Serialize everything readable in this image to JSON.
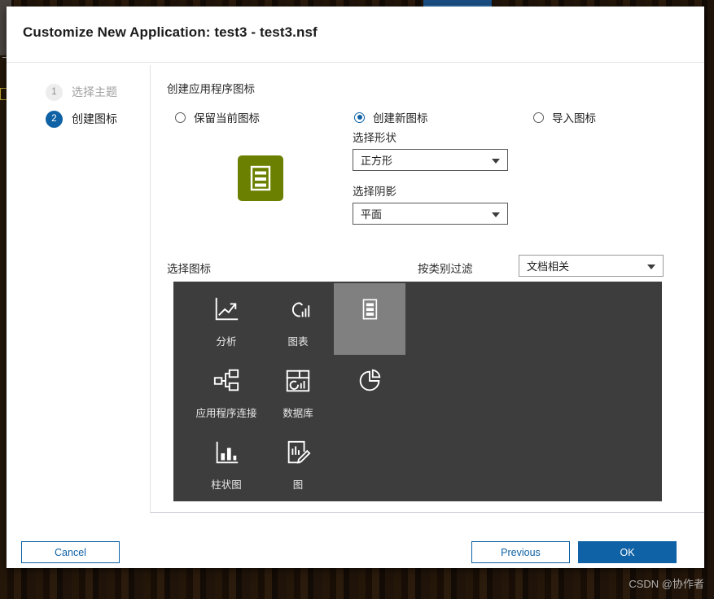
{
  "window": {
    "title": "Customize New Application: test3 - test3.nsf"
  },
  "steps": [
    {
      "number": "1",
      "label": "选择主题",
      "state": "inactive"
    },
    {
      "number": "2",
      "label": "创建图标",
      "state": "active"
    }
  ],
  "content": {
    "section_label": "创建应用程序图标",
    "radios": [
      {
        "label": "保留当前图标",
        "checked": false,
        "name": "keep-current-icon"
      },
      {
        "label": "创建新图标",
        "checked": true,
        "name": "create-new-icon"
      },
      {
        "label": "导入图标",
        "checked": false,
        "name": "import-icon"
      }
    ],
    "shape_field": {
      "label": "选择形状",
      "value": "正方形"
    },
    "shadow_field": {
      "label": "选择阴影",
      "value": "平面"
    },
    "preview": {
      "background_color": "#6b8000",
      "icon": "document-list-icon"
    }
  },
  "chooser": {
    "title": "选择图标",
    "filter_label": "按类别过滤",
    "filter_value": "文档相关",
    "icons": [
      {
        "caption": "分析",
        "icon": "line-chart-arrow-icon",
        "selected": false
      },
      {
        "caption": "图表",
        "icon": "cloud-bars-icon",
        "selected": false
      },
      {
        "caption": "",
        "icon": "document-list-icon",
        "selected": true
      },
      {
        "caption": "应用程序连接",
        "icon": "app-connection-icon",
        "selected": false
      },
      {
        "caption": "数据库",
        "icon": "database-dashboard-icon",
        "selected": false
      },
      {
        "caption": "",
        "icon": "pie-chart-icon",
        "selected": false
      },
      {
        "caption": "柱状图",
        "icon": "bar-chart-icon",
        "selected": false
      },
      {
        "caption": "图",
        "icon": "chart-edit-icon",
        "selected": false
      }
    ]
  },
  "footer": {
    "cancel_label": "Cancel",
    "previous_label": "Previous",
    "ok_label": "OK"
  },
  "watermark": {
    "text": "CSDN @协作者"
  },
  "colors": {
    "accent_blue": "#0f62a5",
    "grid_background": "#3d3d3d",
    "grid_selected": "#808080",
    "preview_green": "#6b8000"
  }
}
